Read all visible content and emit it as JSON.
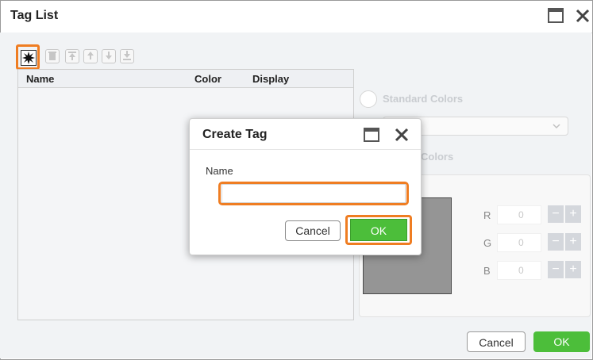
{
  "window": {
    "title": "Tag List",
    "maximize_icon": "window-maximize-icon",
    "close_icon": "close-icon"
  },
  "toolbar": {
    "buttons": [
      {
        "name": "add-tag-button",
        "icon": "starburst-icon",
        "enabled": true
      },
      {
        "name": "delete-button",
        "icon": "trash-icon",
        "enabled": false
      },
      {
        "name": "move-top-button",
        "icon": "arrow-to-top-icon",
        "enabled": false
      },
      {
        "name": "move-up-button",
        "icon": "arrow-up-icon",
        "enabled": false
      },
      {
        "name": "move-down-button",
        "icon": "arrow-down-icon",
        "enabled": false
      },
      {
        "name": "move-bottom-button",
        "icon": "arrow-to-bottom-icon",
        "enabled": false
      }
    ]
  },
  "table": {
    "columns": [
      "Name",
      "Color",
      "Display"
    ],
    "rows": []
  },
  "color_options": {
    "standard_label": "Standard Colors",
    "custom_label_visible": "Colors",
    "rgb": [
      {
        "label": "R",
        "value": "0"
      },
      {
        "label": "G",
        "value": "0"
      },
      {
        "label": "B",
        "value": "0"
      }
    ],
    "preview_color": "#959595"
  },
  "footer": {
    "cancel_label": "Cancel",
    "ok_label": "OK"
  },
  "dialog": {
    "title": "Create Tag",
    "name_label": "Name",
    "name_value": "",
    "cancel_label": "Cancel",
    "ok_label": "OK"
  },
  "colors": {
    "highlight": "#ef7d22",
    "ok_green": "#4cbe3a",
    "disabled_text": "#c9ccd0"
  }
}
